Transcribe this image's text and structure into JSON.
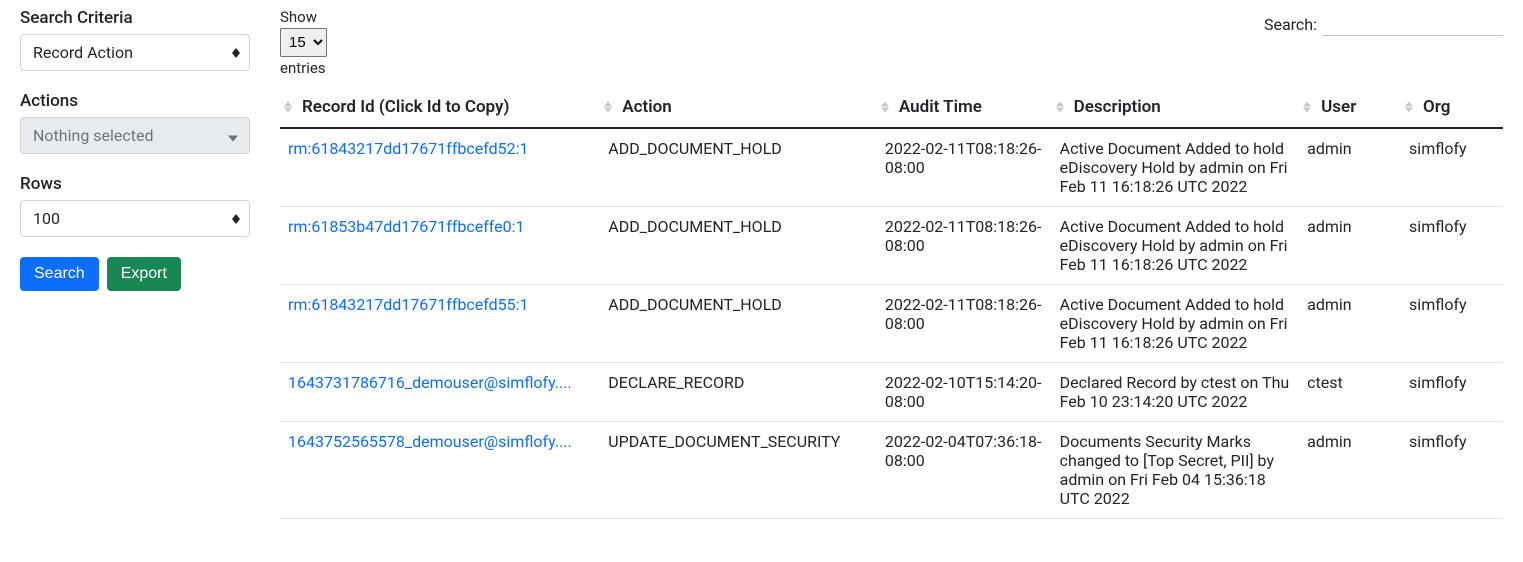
{
  "sidebar": {
    "searchCriteria": {
      "label": "Search Criteria",
      "value": "Record Action"
    },
    "actions": {
      "label": "Actions",
      "value": "Nothing selected"
    },
    "rows": {
      "label": "Rows",
      "value": "100"
    },
    "buttons": {
      "search": "Search",
      "export": "Export"
    }
  },
  "topControls": {
    "show": {
      "labelTop": "Show",
      "labelBottom": "entries",
      "value": "15"
    },
    "search": {
      "label": "Search:",
      "value": ""
    }
  },
  "table": {
    "headers": {
      "recordId": "Record Id (Click Id to Copy)",
      "action": "Action",
      "auditTime": "Audit Time",
      "description": "Description",
      "user": "User",
      "org": "Org"
    },
    "rows": [
      {
        "recordId": "rm:61843217dd17671ffbcefd52:1",
        "action": "ADD_DOCUMENT_HOLD",
        "auditTime": "2022-02-11T08:18:26-08:00",
        "description": "Active Document Added to hold eDiscovery Hold by admin on Fri Feb 11 16:18:26 UTC 2022",
        "user": "admin",
        "org": "simflofy"
      },
      {
        "recordId": "rm:61853b47dd17671ffbceffe0:1",
        "action": "ADD_DOCUMENT_HOLD",
        "auditTime": "2022-02-11T08:18:26-08:00",
        "description": "Active Document Added to hold eDiscovery Hold by admin on Fri Feb 11 16:18:26 UTC 2022",
        "user": "admin",
        "org": "simflofy"
      },
      {
        "recordId": "rm:61843217dd17671ffbcefd55:1",
        "action": "ADD_DOCUMENT_HOLD",
        "auditTime": "2022-02-11T08:18:26-08:00",
        "description": "Active Document Added to hold eDiscovery Hold by admin on Fri Feb 11 16:18:26 UTC 2022",
        "user": "admin",
        "org": "simflofy"
      },
      {
        "recordId": "1643731786716_demouser@simflofy....",
        "action": "DECLARE_RECORD",
        "auditTime": "2022-02-10T15:14:20-08:00",
        "description": "Declared Record by ctest on Thu Feb 10 23:14:20 UTC 2022",
        "user": "ctest",
        "org": "simflofy"
      },
      {
        "recordId": "1643752565578_demouser@simflofy....",
        "action": "UPDATE_DOCUMENT_SECURITY",
        "auditTime": "2022-02-04T07:36:18-08:00",
        "description": "Documents Security Marks changed to [Top Secret, PII] by admin on Fri Feb 04 15:36:18 UTC 2022",
        "user": "admin",
        "org": "simflofy"
      }
    ]
  }
}
